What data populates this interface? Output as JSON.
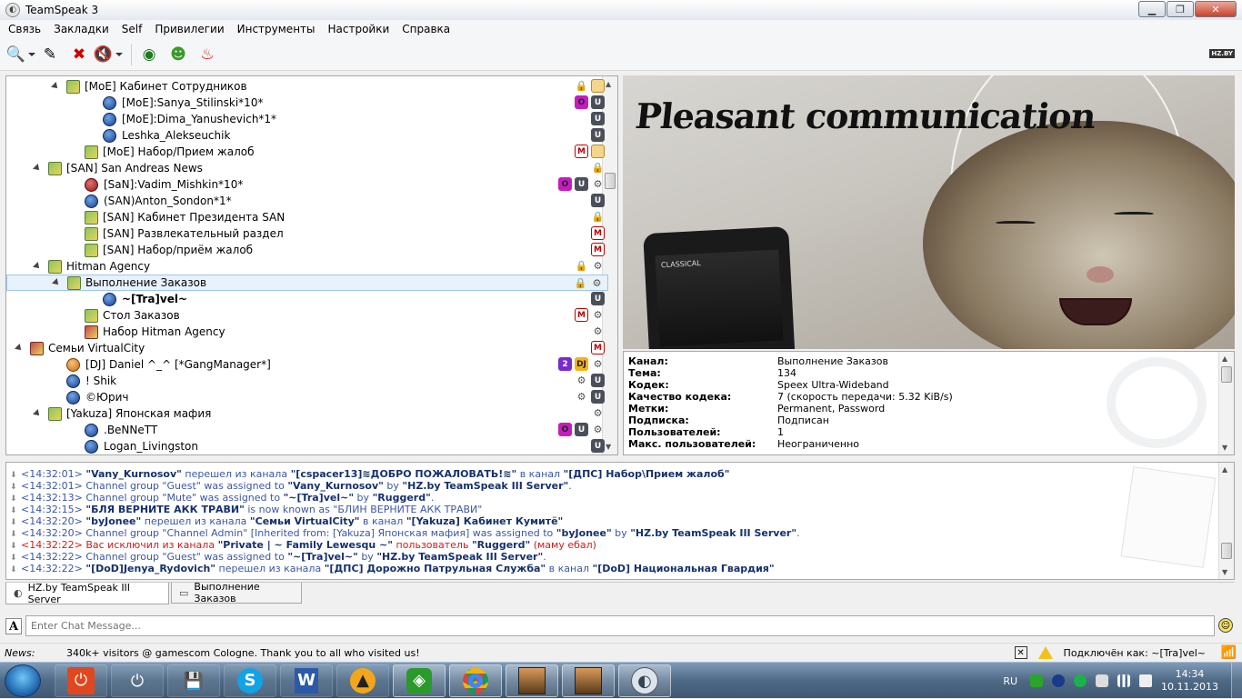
{
  "window": {
    "title": "TeamSpeak 3"
  },
  "menu": [
    "Связь",
    "Закладки",
    "Self",
    "Привилегии",
    "Инструменты",
    "Настройки",
    "Справка"
  ],
  "toolbar": {
    "icons": [
      "connect-icon",
      "bookmark-icon",
      "disconnect-icon",
      "mute-speakers-icon",
      "away-icon",
      "user-icon",
      "red-flame-icon"
    ],
    "logo": "HZ.BY"
  },
  "tree": [
    {
      "label": "[MoE] Кабинет Сотрудников",
      "type": "channel",
      "indent": 1,
      "arrow": true,
      "icons": [
        "lock",
        "fold"
      ]
    },
    {
      "label": "[MoE]:Sanya_Stilinski*10*",
      "type": "user",
      "indent": 3,
      "icons": [
        "O",
        "U"
      ]
    },
    {
      "label": "[MoE]:Dima_Yanushevich*1*",
      "type": "user",
      "indent": 3,
      "icons": [
        "U"
      ]
    },
    {
      "label": "Leshka_Alekseuchik",
      "type": "user",
      "indent": 3,
      "icons": [
        "U"
      ]
    },
    {
      "label": "[MoE] Набор/Прием жалоб",
      "type": "channel",
      "indent": 2,
      "icons": [
        "M",
        "fold"
      ]
    },
    {
      "label": "[SAN] San Andreas News",
      "type": "channel",
      "indent": 0,
      "arrow": true,
      "icons": [
        "lock"
      ]
    },
    {
      "label": "[SaN]:Vadim_Mishkin*10*",
      "type": "user-mic",
      "indent": 2,
      "icons": [
        "O",
        "U",
        "misc"
      ]
    },
    {
      "label": "(SAN)Anton_Sondon*1*",
      "type": "user",
      "indent": 2,
      "icons": [
        "U"
      ]
    },
    {
      "label": "[SAN] Кабинет Президента SAN",
      "type": "channel",
      "indent": 2,
      "icons": [
        "lock"
      ]
    },
    {
      "label": "[SAN] Развлекательный раздел",
      "type": "channel",
      "indent": 2,
      "icons": [
        "M"
      ]
    },
    {
      "label": "[SAN] Набор/приём жалоб",
      "type": "channel",
      "indent": 2,
      "icons": [
        "M"
      ]
    },
    {
      "label": "Hitman Agency",
      "type": "channel",
      "indent": 0,
      "arrow": true,
      "icons": [
        "lock",
        "misc"
      ]
    },
    {
      "label": "Выполнение Заказов",
      "type": "channel",
      "indent": 1,
      "arrow": true,
      "selected": true,
      "icons": [
        "lock",
        "misc"
      ]
    },
    {
      "label": "~[Tra]vel~",
      "type": "user",
      "indent": 3,
      "bold": true,
      "icons": [
        "U"
      ]
    },
    {
      "label": "Стол Заказов",
      "type": "channel",
      "indent": 2,
      "icons": [
        "M",
        "misc"
      ]
    },
    {
      "label": "Набор Hitman Agency",
      "type": "channel-red",
      "indent": 2,
      "icons": [
        "misc"
      ]
    },
    {
      "label": "Семьи VirtualCity",
      "type": "channel-red",
      "indent": -1,
      "arrow": true,
      "icons": [
        "M"
      ]
    },
    {
      "label": "[DJ] Daniel ^_^ [*GangManager*]",
      "type": "user-or",
      "indent": 1,
      "icons": [
        "two",
        "dj",
        "misc"
      ]
    },
    {
      "label": "! Shik",
      "type": "user",
      "indent": 1,
      "icons": [
        "misc",
        "U"
      ]
    },
    {
      "label": "©Юрич",
      "type": "user",
      "indent": 1,
      "icons": [
        "misc",
        "U"
      ]
    },
    {
      "label": "[Yakuza] Японская мафия",
      "type": "channel",
      "indent": 0,
      "arrow": true,
      "icons": [
        "misc"
      ]
    },
    {
      "label": ".BeNNeTT",
      "type": "user",
      "indent": 2,
      "icons": [
        "O",
        "U",
        "misc"
      ]
    },
    {
      "label": "Logan_Livingston",
      "type": "user",
      "indent": 2,
      "icons": [
        "U"
      ]
    }
  ],
  "banner": {
    "slogan": "Pleasant communication",
    "phone_text": "CLASSICAL"
  },
  "info": [
    {
      "k": "Канал:",
      "v": "Выполнение Заказов"
    },
    {
      "k": "Тема:",
      "v": "134"
    },
    {
      "k": "Кодек:",
      "v": "Speex Ultra-Wideband"
    },
    {
      "k": "Качество кодека:",
      "v": "7 (скорость передачи: 5.32 KiB/s)"
    },
    {
      "k": "Метки:",
      "v": "Permanent, Password"
    },
    {
      "k": "Подписка:",
      "v": "Подписан"
    },
    {
      "k": "Пользователей:",
      "v": "1"
    },
    {
      "k": "Макс. пользователей:",
      "v": "Неограниченно"
    }
  ],
  "chat": [
    {
      "parts": [
        [
          "t",
          "<14:32:01> "
        ],
        [
          "b",
          "\"Vany_Kurnosov\""
        ],
        [
          "t",
          " перешел из канала "
        ],
        [
          "b",
          "\"[cspacer13]≋ДОБРО ПОЖАЛОВАТЬ!≋\""
        ],
        [
          "t",
          " в канал "
        ],
        [
          "b",
          "\"[ДПС] Набор\\Прием жалоб\""
        ]
      ]
    },
    {
      "parts": [
        [
          "t",
          "<14:32:01> Channel group \"Guest\" was assigned to "
        ],
        [
          "b",
          "\"Vany_Kurnosov\""
        ],
        [
          "t",
          " by "
        ],
        [
          "b",
          "\"HZ.by TeamSpeak III Server\""
        ],
        [
          "t",
          "."
        ]
      ]
    },
    {
      "parts": [
        [
          "t",
          "<14:32:13> Channel group \"Mute\" was assigned to "
        ],
        [
          "b",
          "\"~[Tra]vel~\""
        ],
        [
          "t",
          " by "
        ],
        [
          "b",
          "\"Ruggerd\""
        ],
        [
          "t",
          "."
        ]
      ]
    },
    {
      "parts": [
        [
          "t",
          "<14:32:15> "
        ],
        [
          "b",
          "\"БЛЯ ВЕРНИТЕ АКК ТРАВИ\""
        ],
        [
          "t",
          " is now known as \"БЛИН ВЕРНИТЕ АКК ТРАВИ\""
        ]
      ]
    },
    {
      "parts": [
        [
          "t",
          "<14:32:20> "
        ],
        [
          "b",
          "\"byJonee\""
        ],
        [
          "t",
          " перешел из канала "
        ],
        [
          "b",
          "\"Семьи VirtualCity\""
        ],
        [
          "t",
          " в канал "
        ],
        [
          "b",
          "\"[Yakuza] Кабинет Кумитё\""
        ]
      ]
    },
    {
      "parts": [
        [
          "t",
          "<14:32:20> Channel group \"Channel Admin\" [Inherited from: [Yakuza] Японская мафия] was assigned to "
        ],
        [
          "b",
          "\"byJonee\""
        ],
        [
          "t",
          " by "
        ],
        [
          "b",
          "\"HZ.by TeamSpeak III Server\""
        ],
        [
          "t",
          "."
        ]
      ]
    },
    {
      "red": true,
      "parts": [
        [
          "t",
          "<14:32:22> Вас исключил из канала "
        ],
        [
          "b",
          "\"Private | ~ Family Lewesqu ~\""
        ],
        [
          "t",
          " пользователь "
        ],
        [
          "b",
          "\"Ruggerd\""
        ],
        [
          "t",
          " (маму ебал)"
        ]
      ]
    },
    {
      "parts": [
        [
          "t",
          "<14:32:22> Channel group \"Guest\" was assigned to "
        ],
        [
          "b",
          "\"~[Tra]vel~\""
        ],
        [
          "t",
          " by "
        ],
        [
          "b",
          "\"HZ.by TeamSpeak III Server\""
        ],
        [
          "t",
          "."
        ]
      ]
    },
    {
      "parts": [
        [
          "t",
          "<14:32:22> "
        ],
        [
          "b",
          "\"[DoD]Jenya_Rydovich\""
        ],
        [
          "t",
          " перешел из канала "
        ],
        [
          "b",
          "\"[ДПС] Дорожно Патрульная Служба\""
        ],
        [
          "t",
          " в канал "
        ],
        [
          "b",
          "\"[DoD] Национальная Гвардия\""
        ]
      ]
    }
  ],
  "tabs": [
    {
      "label": "HZ.by TeamSpeak III Server",
      "icon": "server-icon",
      "active": true
    },
    {
      "label": "Выполнение Заказов",
      "icon": "channel-chat-icon",
      "active": false
    }
  ],
  "chat_input": {
    "placeholder": "Enter Chat Message..."
  },
  "status": {
    "news_label": "News:",
    "news_text": "340k+ visitors @ gamescom Cologne. Thank you to all who visited us!",
    "connected": "Подключён как: ~[Tra]vel~"
  },
  "taskbar": {
    "lang": "RU",
    "time": "14:34",
    "date": "10.11.2013"
  }
}
